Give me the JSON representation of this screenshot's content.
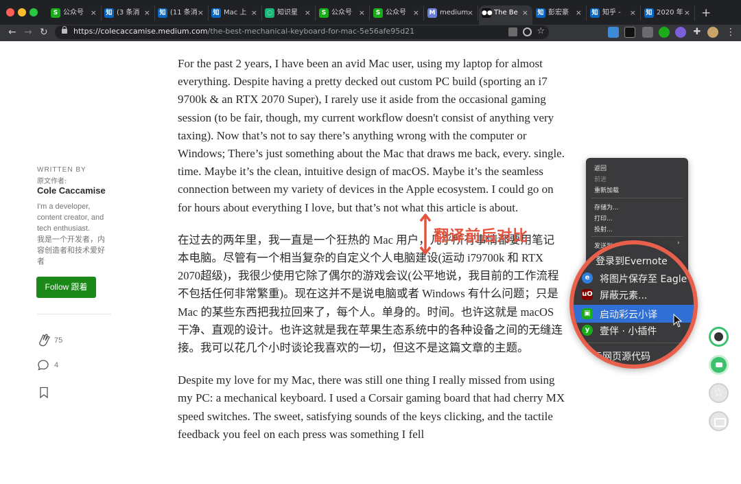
{
  "browser": {
    "tabs": [
      {
        "label": "公众号",
        "fav": "S",
        "color": "#1aad19"
      },
      {
        "label": "(3 条消",
        "fav": "知",
        "color": "#0a66c2"
      },
      {
        "label": "(11 条消",
        "fav": "知",
        "color": "#0a66c2"
      },
      {
        "label": "Mac 上",
        "fav": "知",
        "color": "#0a66c2"
      },
      {
        "label": "知识星",
        "fav": "◌",
        "color": "#16b777"
      },
      {
        "label": "公众号",
        "fav": "S",
        "color": "#1aad19"
      },
      {
        "label": "公众号",
        "fav": "S",
        "color": "#1aad19"
      },
      {
        "label": "medium",
        "fav": "M",
        "color": "#6c7fd8"
      },
      {
        "label": "The Be",
        "fav": "●●",
        "color": "#111111"
      },
      {
        "label": "彭宏豪",
        "fav": "知",
        "color": "#0a66c2"
      },
      {
        "label": "知乎 - ",
        "fav": "知",
        "color": "#0a66c2"
      },
      {
        "label": "2020 年",
        "fav": "知",
        "color": "#0a66c2"
      }
    ],
    "active_tab_index": 8,
    "close_glyph": "×",
    "new_tab_glyph": "+",
    "url_host": "https://colecaccamise.medium.com",
    "url_path": "/the-best-mechanical-keyboard-for-mac-5e56afe95d21"
  },
  "sidebar": {
    "written_by": "WRITTEN BY",
    "original_author_label": "原文作者:",
    "author": "Cole Caccamise",
    "bio": "I'm a developer, content creator, and tech enthusiast.\n我是一个开发者，内容创造者和技术爱好者",
    "follow_label": "Follow 跟着",
    "claps": "75",
    "comments": "4"
  },
  "article": {
    "p1": "For the past 2 years, I have been an avid Mac user, using my laptop for almost everything. Despite having a pretty decked out custom PC build (sporting an i7 9700k & an RTX 2070 Super), I rarely use it aside from the occasional gaming session (to be fair, though, my current workflow doesn't consist of anything very taxing). Now that’s not to say there’s anything wrong with the computer or Windows; There’s just something about the Mac that draws me back, every. single. time. Maybe it’s the clean, intuitive design of macOS. Maybe it’s the seamless connection between my variety of devices in the Apple ecosystem. I could go on for hours about everything I love, but that’s not what this article is about.",
    "p2": "在过去的两年里，我一直是一个狂热的 Mac 用户，几乎所有事情都要用笔记本电脑。尽管有一个相当复杂的自定义个人电脑建设(运动 i79700k 和 RTX 2070超级)，我很少使用它除了偶尔的游戏会议(公平地说，我目前的工作流程不包括任何非常繁重)。现在这并不是说电脑或者 Windows 有什么问题；只是 Mac 的某些东西把我拉回来了，每个人。单身的。时间。也许这就是 macOS 干净、直观的设计。也许这就是我在苹果生态系统中的各种设备之间的无缝连接。我可以花几个小时谈论我喜欢的一切，但这不是这篇文章的主题。",
    "p3": "Despite my love for my Mac, there was still one thing I really missed from using my PC: a mechanical keyboard. I used a Corsair gaming board that had cherry MX speed switches. The sweet, satisfying sounds of the keys clicking, and the tactile feedback you feel on each press was something I fell"
  },
  "annotation": {
    "text": "翻译前后对比",
    "color": "#e5533e"
  },
  "context_menu": {
    "back": "返回",
    "forward": "前进",
    "reload": "重新加载",
    "save_as": "存储为...",
    "print": "打印...",
    "cast": "投射...",
    "send_to": "发送到"
  },
  "magnified_menu": {
    "evernote": "登录到Evernote",
    "eagle": "将图片保存至 Eagle",
    "block": "屏蔽元素...",
    "caiyun": "启动彩云小译",
    "yiban": "壹伴 · 小插件",
    "view_source": "示网页源代码"
  }
}
